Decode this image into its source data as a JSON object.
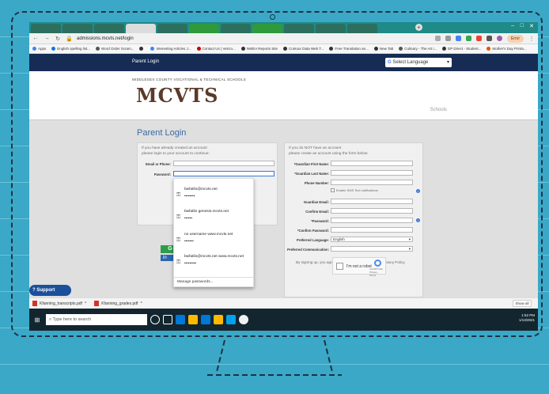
{
  "browser": {
    "url": "admissions.mcvts.net/login",
    "tabs": [
      "",
      "",
      "",
      "",
      "",
      "",
      "",
      "",
      "",
      "",
      ""
    ],
    "active_tab_index": 5,
    "edit_label": "Error",
    "bookmarks": [
      {
        "label": "Apps",
        "color": "#4285f4"
      },
      {
        "label": "English spelling list...",
        "color": "#1a73e8"
      },
      {
        "label": "Word Order Scram...",
        "color": "#555555"
      },
      {
        "label": "",
        "color": "#333333"
      },
      {
        "label": "Interesting Articles J...",
        "color": "#4285f4"
      },
      {
        "label": "Contact Us | Verizo...",
        "color": "#cc0000"
      },
      {
        "label": "NWEA Reports Site",
        "color": "#333333"
      },
      {
        "label": "Contour Data Web T...",
        "color": "#333333"
      },
      {
        "label": "Free Translation an...",
        "color": "#333333"
      },
      {
        "label": "New Tab",
        "color": "#333333"
      },
      {
        "label": "Culinary - The Art i...",
        "color": "#555555"
      },
      {
        "label": "EP Direct - Student...",
        "color": "#333333"
      },
      {
        "label": "Mother's Day Printa...",
        "color": "#e65100"
      }
    ]
  },
  "site": {
    "header_title": "Parent Login",
    "language_select": "Select Language",
    "school_name": "MIDDLESEX COUNTY VOCATIONAL & TECHNICAL SCHOOLS",
    "logo_text": "MCVTS",
    "schools_link": "Schools"
  },
  "login": {
    "page_title": "Parent Login",
    "note_line1": "If you have already created an account",
    "note_line2": "please login to your account to continue:",
    "email_label": "Email or Phone:",
    "password_label": "Password:",
    "google_letter": "G",
    "linkedin_letter": "in"
  },
  "register": {
    "note_line1": "If you do NOT have an account",
    "note_line2": "please create an account using the form below:",
    "fields": [
      {
        "label": "*Guardian First Name:",
        "value": ""
      },
      {
        "label": "*Guardian Last Name:",
        "value": ""
      },
      {
        "label": "Phone Number:",
        "value": ""
      },
      {
        "label": "Guardian Email:",
        "value": ""
      },
      {
        "label": "Confirm Email:",
        "value": ""
      },
      {
        "label": "*Password:",
        "value": ""
      },
      {
        "label": "*Confirm Password:",
        "value": ""
      },
      {
        "label": "Preferred Language:",
        "value": "English"
      },
      {
        "label": "Preferred Communication:",
        "value": ""
      }
    ],
    "sms_checkbox_label": "Enable SMS Text notifications",
    "terms_text": "By signing up, you agree to the Terms of Service and Privacy Policy.",
    "recaptcha_label": "I'm not a robot",
    "recaptcha_brand": "reCAPTCHA",
    "recaptcha_links": "Privacy - Terms"
  },
  "password_dropdown": {
    "items": [
      {
        "user": "bwfatlin@mcvts.net",
        "password": "••••••••"
      },
      {
        "user": "bwfatlin   genesis.mcvts.net",
        "password": "••••••"
      },
      {
        "user": "no username   www.mcvts.net",
        "password": "•••••••"
      },
      {
        "user": "bwfatlin@mcvts.net   www.mcvts.net",
        "password": "•••••••••"
      }
    ],
    "manage_label": "Manage passwords..."
  },
  "support_label": "Support",
  "downloads": {
    "files": [
      "Kfanning_transcripts.pdf",
      "Kfanning_grades.pdf"
    ],
    "show_all": "Show all"
  },
  "taskbar": {
    "search_placeholder": "Type here to search",
    "time": "1:52 PM",
    "date": "1/13/2021",
    "icon_colors": [
      "#ffffff",
      "#ffffff",
      "#0078d7",
      "#ffb900",
      "#0078d7",
      "#ffb900",
      "#00a2ed",
      "#ffffff"
    ]
  }
}
